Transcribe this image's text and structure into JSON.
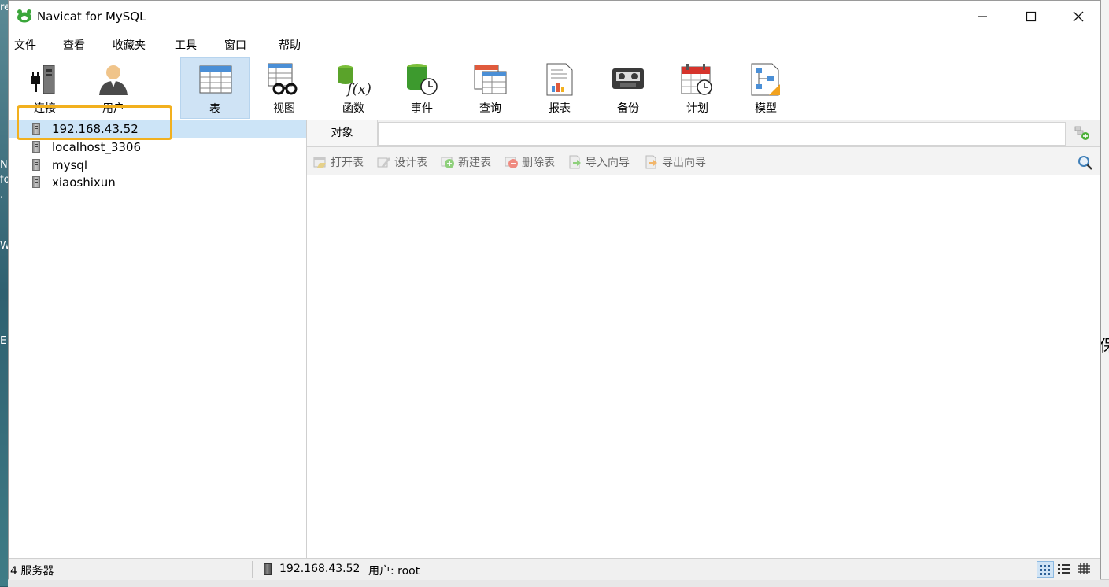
{
  "window": {
    "title": "Navicat for MySQL"
  },
  "menu": [
    "文件",
    "查看",
    "收藏夹",
    "工具",
    "窗口",
    "帮助"
  ],
  "toolbar": {
    "connect": "连接",
    "user": "用户",
    "table": "表",
    "view": "视图",
    "function": "函数",
    "event": "事件",
    "query": "查询",
    "report": "报表",
    "backup": "备份",
    "schedule": "计划",
    "model": "模型"
  },
  "connections": [
    {
      "name": "192.168.43.52",
      "selected": true
    },
    {
      "name": "localhost_3306",
      "selected": false
    },
    {
      "name": "mysql",
      "selected": false
    },
    {
      "name": "xiaoshixun",
      "selected": false
    }
  ],
  "tabs": {
    "objects": "对象"
  },
  "object_toolbar": {
    "open": "打开表",
    "design": "设计表",
    "new": "新建表",
    "delete": "删除表",
    "import": "导入向导",
    "export": "导出向导"
  },
  "status": {
    "count": "4 服务器",
    "connection": "192.168.43.52",
    "user": "用户: root"
  },
  "desktop": {
    "left_chars": [
      "re",
      "N",
      "fo",
      ".",
      "W",
      "E"
    ],
    "right_char": "保"
  },
  "colors": {
    "selection": "#cce4f7",
    "highlight": "#f2b01e",
    "active_tool": "#cfe3f5"
  }
}
